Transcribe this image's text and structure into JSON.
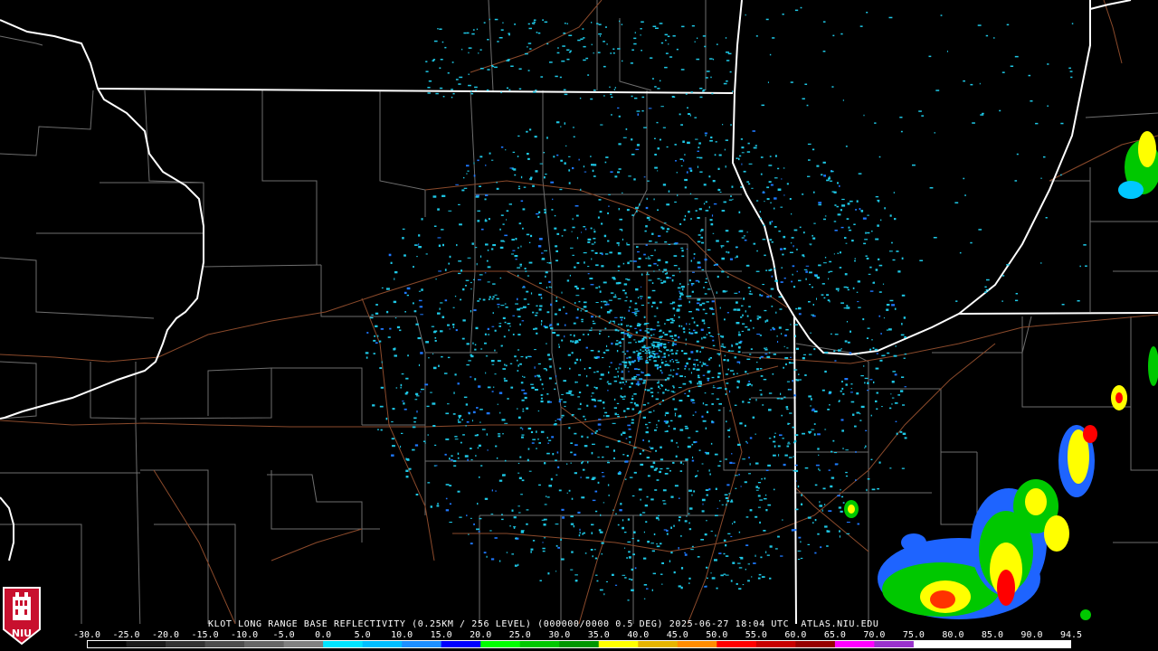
{
  "title": "KLOT LONG RANGE BASE REFLECTIVITY (0.25KM / 256 LEVEL) (000000/0000 0.5 DEG) 2025-06-27 18:04 UTC  ATLAS.NIU.EDU",
  "logo_text": "NIU",
  "colorbar": {
    "labels": [
      "-30.0",
      "-25.0",
      "-20.0",
      "-15.0",
      "-10.0",
      "-5.0",
      "0.0",
      "5.0",
      "10.0",
      "15.0",
      "20.0",
      "25.0",
      "30.0",
      "35.0",
      "40.0",
      "45.0",
      "50.0",
      "55.0",
      "60.0",
      "65.0",
      "70.0",
      "75.0",
      "80.0",
      "85.0",
      "90.0",
      "94.5"
    ],
    "colors": [
      "#000000",
      "#1a1a1a",
      "#333333",
      "#4d4d4d",
      "#666666",
      "#808080",
      "#00e5ff",
      "#00bfff",
      "#1e90ff",
      "#0000ff",
      "#00ff00",
      "#00c800",
      "#009600",
      "#ffff00",
      "#e6b400",
      "#ff8c00",
      "#ff0000",
      "#c80000",
      "#960000",
      "#ff00ff",
      "#9932cc",
      "#ffffff",
      "#ffffff",
      "#ffffff",
      "#ffffff"
    ]
  },
  "colors": {
    "state_border": "#ffffff",
    "county_line": "#7a7a7a",
    "roads": "#8b4a2b",
    "echo_light": "#1ec8e6",
    "echo_mid": "#1e78ff"
  }
}
